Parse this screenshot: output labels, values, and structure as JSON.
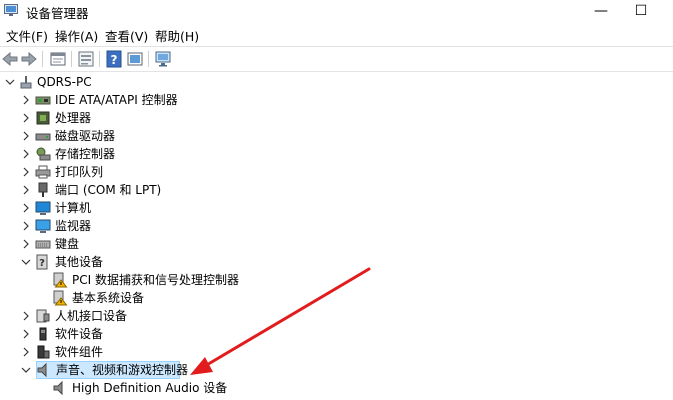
{
  "window": {
    "title": "设备管理器",
    "minimize": "—",
    "maximize": "☐"
  },
  "menu": [
    "文件(F)",
    "操作(A)",
    "查看(V)",
    "帮助(H)"
  ],
  "tree": {
    "root": "QDRS-PC",
    "categories": [
      "IDE ATA/ATAPI 控制器",
      "处理器",
      "磁盘驱动器",
      "存储控制器",
      "打印队列",
      "端口 (COM 和 LPT)",
      "计算机",
      "监视器",
      "键盘",
      "其他设备",
      "人机接口设备",
      "软件设备",
      "软件组件",
      "声音、视频和游戏控制器"
    ],
    "other_devices": [
      "PCI 数据捕获和信号处理控制器",
      "基本系统设备"
    ],
    "audio_devices": [
      "High Definition Audio 设备"
    ]
  },
  "colors": {
    "selection": "#cce8ff",
    "arrow": "#e21c1c",
    "warning": "#f2b300"
  }
}
